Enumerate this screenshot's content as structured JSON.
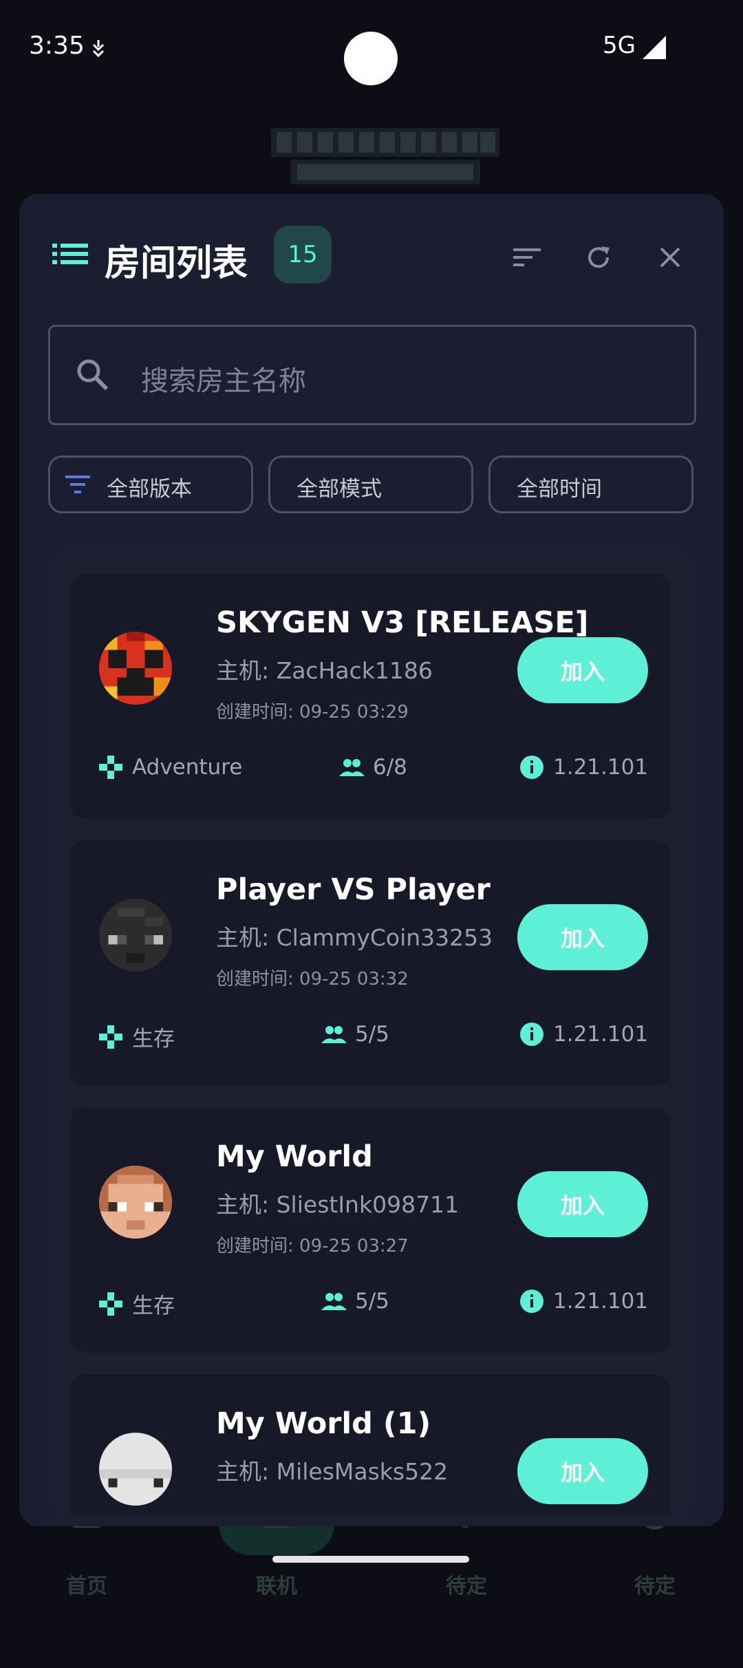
{
  "status_bar": {
    "time": "3:35",
    "network": "5G"
  },
  "bottom_nav": [
    {
      "label": "首页",
      "icon": "home-icon"
    },
    {
      "label": "联机",
      "icon": "group-icon"
    },
    {
      "label": "待定",
      "icon": "gear-icon"
    },
    {
      "label": "待定",
      "icon": "info-icon"
    }
  ],
  "header": {
    "title": "房间列表",
    "count": "15"
  },
  "search": {
    "placeholder": "搜索房主名称"
  },
  "filters": [
    {
      "label": "全部版本"
    },
    {
      "label": "全部模式"
    },
    {
      "label": "全部时间"
    }
  ],
  "rooms": [
    {
      "name": "SKYGEN V3 [RELEASE]",
      "host": "主机: ZacHack1186",
      "created": "创建时间: 09-25 03:29",
      "mode": "Adventure",
      "players": "6/8",
      "version": "1.21.101",
      "join": "加入"
    },
    {
      "name": "Player VS Player",
      "host": "主机: ClammyCoin33253",
      "created": "创建时间: 09-25 03:32",
      "mode": "生存",
      "players": "5/5",
      "version": "1.21.101",
      "join": "加入"
    },
    {
      "name": "My World",
      "host": "主机: SliestInk098711",
      "created": "创建时间: 09-25 03:27",
      "mode": "生存",
      "players": "5/5",
      "version": "1.21.101",
      "join": "加入"
    },
    {
      "name": "My World (1)",
      "host": "主机: MilesMasks522",
      "created": "",
      "mode": "",
      "players": "",
      "version": "",
      "join": "加入"
    }
  ],
  "colors": {
    "accent": "#5ef0d6",
    "panel": "#1b1d30",
    "card": "#171929"
  }
}
